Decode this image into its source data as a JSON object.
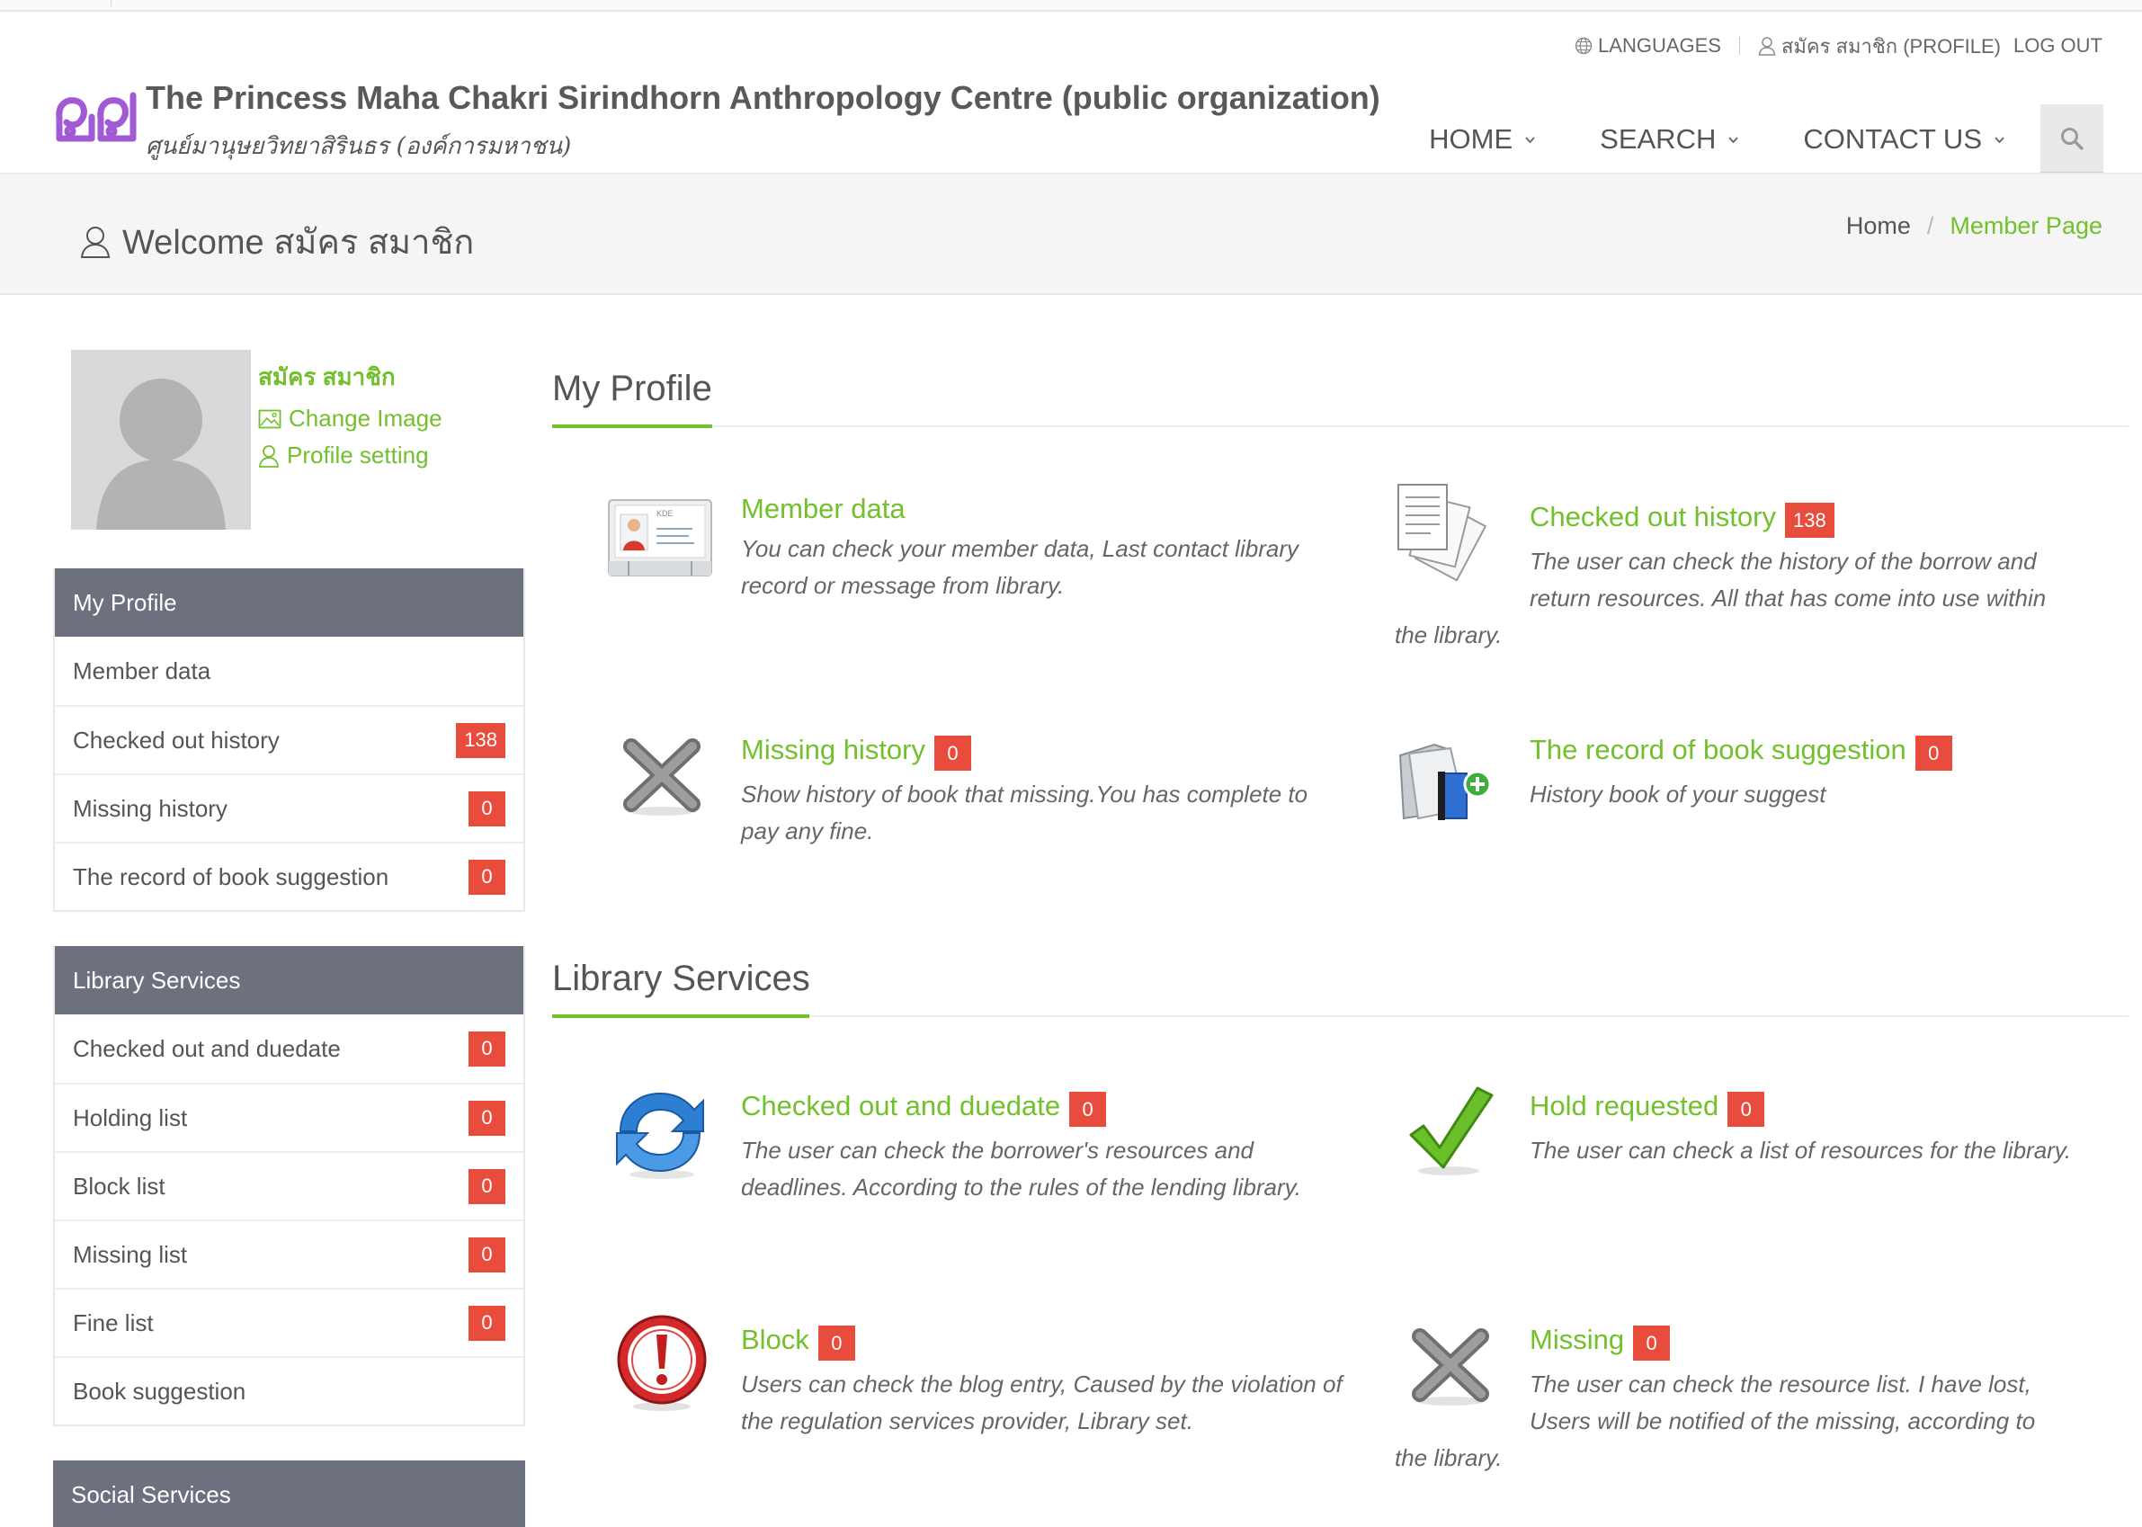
{
  "header": {
    "languages_label": "LANGUAGES",
    "profile_label": "สมัคร สมาชิก (PROFILE)",
    "logout_label": "LOG OUT",
    "site_title": "The Princess Maha Chakri Sirindhorn Anthropology Centre (public organization)",
    "site_subtitle": "ศูนย์มานุษยวิทยาสิรินธร (องค์การมหาชน)",
    "nav": [
      {
        "label": "HOME",
        "icon": "chevron-down-icon"
      },
      {
        "label": "SEARCH",
        "icon": "chevron-down-icon"
      },
      {
        "label": "CONTACT US",
        "icon": "chevron-down-icon"
      }
    ],
    "colors": {
      "accent": "#72c02c",
      "logo": "#a05ad6",
      "nav_text": "#555555"
    }
  },
  "titlebar": {
    "welcome": "Welcome สมัคร สมาชิก",
    "breadcrumb_home": "Home",
    "breadcrumb_separator": "/",
    "breadcrumb_current": "Member Page"
  },
  "profile": {
    "name": "สมัคร สมาชิก",
    "change_image": "Change Image",
    "profile_setting": "Profile setting"
  },
  "sidebar": {
    "my_profile": {
      "title": "My Profile",
      "items": [
        {
          "label": "Member data",
          "count": null
        },
        {
          "label": "Checked out history",
          "count": "138"
        },
        {
          "label": "Missing history",
          "count": "0"
        },
        {
          "label": "The record of book suggestion",
          "count": "0"
        }
      ]
    },
    "library_services": {
      "title": "Library Services",
      "items": [
        {
          "label": "Checked out and duedate",
          "count": "0"
        },
        {
          "label": "Holding list",
          "count": "0"
        },
        {
          "label": "Block list",
          "count": "0"
        },
        {
          "label": "Missing list",
          "count": "0"
        },
        {
          "label": "Fine list",
          "count": "0"
        },
        {
          "label": "Book suggestion",
          "count": null
        }
      ]
    },
    "social_services": {
      "title": "Social Services"
    },
    "colors": {
      "panel_head": "#6d717d",
      "badge": "#e74c3c"
    }
  },
  "main": {
    "my_profile": {
      "title": "My Profile",
      "cards": [
        {
          "title": "Member data",
          "badge": null,
          "desc": "You can check your member data, Last contact library record or message from library.",
          "icon": "id-card-icon"
        },
        {
          "title": "Checked out history",
          "badge": "138",
          "desc": "The user can check the history of the borrow and return resources. All that has come into use within the library.",
          "icon": "documents-icon"
        },
        {
          "title": "Missing history",
          "badge": "0",
          "desc": "Show history of book that missing.You has complete to pay any fine.",
          "icon": "x-mark-icon"
        },
        {
          "title": "The record of book suggestion",
          "badge": "0",
          "desc": "History book of your suggest",
          "icon": "folder-add-icon"
        }
      ]
    },
    "library_services": {
      "title": "Library Services",
      "cards": [
        {
          "title": "Checked out and duedate",
          "badge": "0",
          "desc": "The user can check the borrower's resources and deadlines. According to the rules of the lending library.",
          "icon": "refresh-icon"
        },
        {
          "title": "Hold requested",
          "badge": "0",
          "desc": "The user can check a list of resources for the library.",
          "icon": "checkmark-icon"
        },
        {
          "title": "Block",
          "badge": "0",
          "desc": "Users can check the blog entry, Caused by the violation of the regulation services provider, Library set.",
          "icon": "alert-icon"
        },
        {
          "title": "Missing",
          "badge": "0",
          "desc": "The user can check the resource list. I have lost, Users will be notified of the missing, according to the library.",
          "icon": "x-mark-icon"
        }
      ]
    }
  }
}
